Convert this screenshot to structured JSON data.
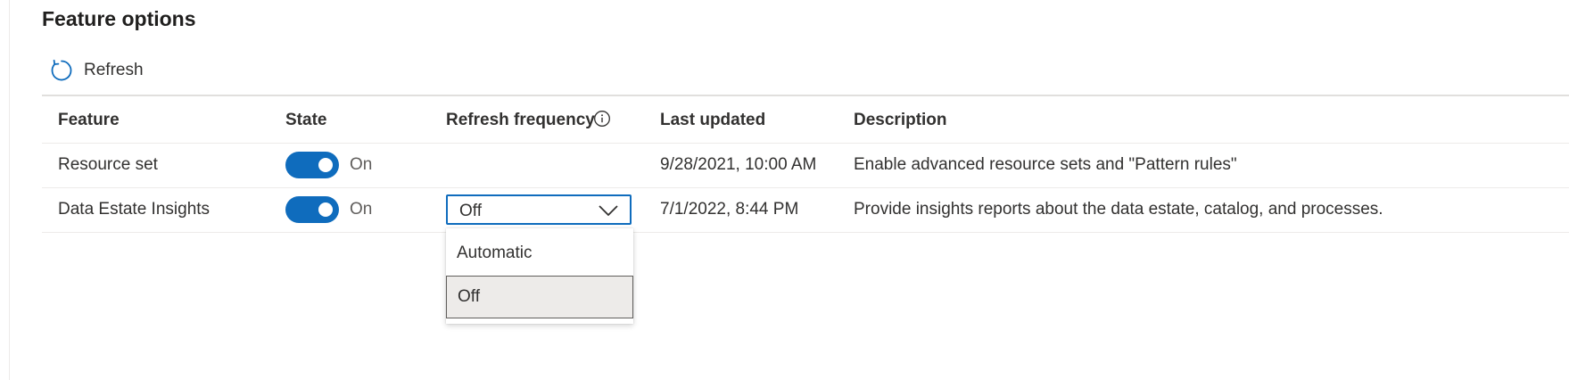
{
  "page": {
    "title": "Feature options"
  },
  "toolbar": {
    "refresh_label": "Refresh"
  },
  "table": {
    "columns": {
      "feature": "Feature",
      "state": "State",
      "refresh_frequency": "Refresh frequency",
      "last_updated": "Last updated",
      "description": "Description"
    },
    "rows": [
      {
        "feature": "Resource set",
        "state": "On",
        "state_on": true,
        "refresh_frequency": "",
        "last_updated": "9/28/2021, 10:00 AM",
        "description": "Enable advanced resource sets and \"Pattern rules\""
      },
      {
        "feature": "Data Estate Insights",
        "state": "On",
        "state_on": true,
        "refresh_frequency": "Off",
        "last_updated": "7/1/2022, 8:44 PM",
        "description": "Provide insights reports about the data estate, catalog, and processes."
      }
    ]
  },
  "dropdown": {
    "selected": "Off",
    "expanded": true,
    "options": [
      "Automatic",
      "Off"
    ]
  },
  "icons": {
    "refresh": "refresh-icon",
    "info": "info-icon",
    "chevron": "chevron-down-icon"
  },
  "colors": {
    "accent": "#0f6cbd",
    "selected_option_bg": "#edebe9",
    "text": "#323130"
  }
}
